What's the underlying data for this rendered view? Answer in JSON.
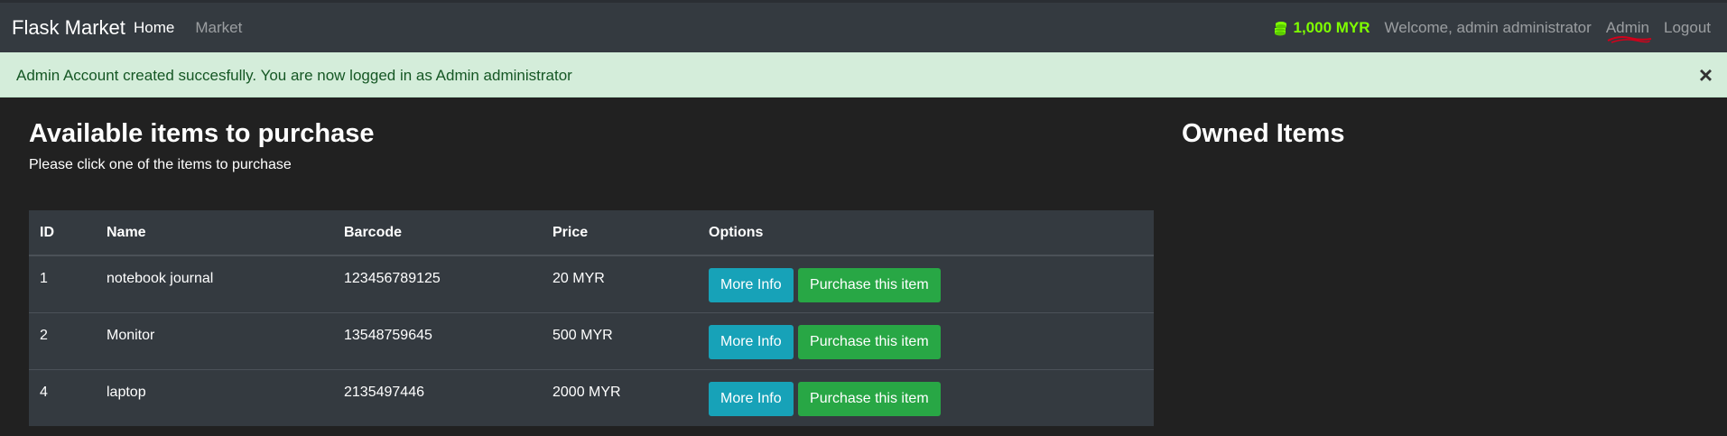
{
  "navbar": {
    "brand": "Flask Market",
    "links": [
      {
        "label": "Home",
        "active": true
      },
      {
        "label": "Market",
        "active": false
      }
    ],
    "budget": "1,000 MYR",
    "welcome": "Welcome, admin administrator",
    "admin_label": "Admin",
    "logout_label": "Logout"
  },
  "alert": {
    "message": "Admin Account created succesfully. You are now logged in as Admin administrator",
    "close_symbol": "×"
  },
  "market": {
    "title": "Available items to purchase",
    "subtitle": "Please click one of the items to purchase",
    "columns": [
      "ID",
      "Name",
      "Barcode",
      "Price",
      "Options"
    ],
    "rows": [
      {
        "id": "1",
        "name": "notebook journal",
        "barcode": "123456789125",
        "price": "20 MYR"
      },
      {
        "id": "2",
        "name": "Monitor",
        "barcode": "13548759645",
        "price": "500 MYR"
      },
      {
        "id": "4",
        "name": "laptop",
        "barcode": "2135497446",
        "price": "2000 MYR"
      }
    ],
    "more_info_label": "More Info",
    "purchase_label": "Purchase this item"
  },
  "owned": {
    "title": "Owned Items"
  },
  "colors": {
    "navbar_bg": "#343a40",
    "page_bg": "#212121",
    "alert_bg": "#d4edda",
    "alert_text": "#155724",
    "budget": "#7fff00",
    "info_button": "#17a2b8",
    "success_button": "#28a745"
  },
  "icons": {
    "budget": "coins-icon",
    "close": "close-icon"
  }
}
